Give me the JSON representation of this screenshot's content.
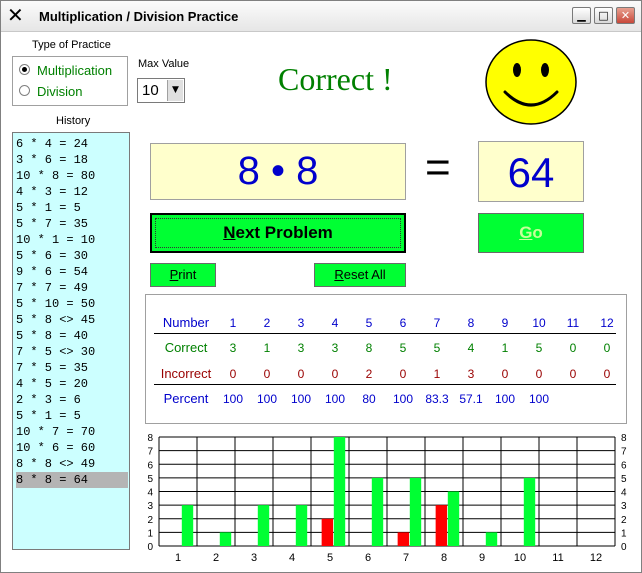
{
  "window": {
    "title": "Multiplication / Division Practice",
    "app_icon": "✕",
    "controls": [
      "minimize",
      "maximize",
      "close"
    ]
  },
  "type_of_practice": {
    "label": "Type of Practice",
    "options": [
      {
        "label": "Multiplication",
        "selected": true
      },
      {
        "label": "Division",
        "selected": false
      }
    ]
  },
  "max_value": {
    "label": "Max Value",
    "value": "10"
  },
  "history": {
    "label": "History",
    "items": [
      "6 * 4 = 24",
      "3 * 6 = 18",
      "10 * 8 = 80",
      "4 * 3 = 12",
      "5 * 1 = 5",
      "5 * 7 = 35",
      "10 * 1 = 10",
      "5 * 6 = 30",
      "9 * 6 = 54",
      "7 * 7 = 49",
      "5 * 10 = 50",
      "5 * 8 <> 45",
      "5 * 8 = 40",
      "7 * 5 <> 30",
      "7 * 5 = 35",
      "4 * 5 = 20",
      "2 * 3 = 6",
      "5 * 1 = 5",
      "10 * 7 = 70",
      "10 * 6 = 60",
      "8 * 8 <> 49",
      "8 * 8 = 64"
    ],
    "selected_index": 21
  },
  "feedback": {
    "message": "Correct !",
    "icon": "smiley-face-icon"
  },
  "problem": {
    "text": "8  •  8",
    "equals": "=",
    "answer": "64"
  },
  "buttons": {
    "next_problem": {
      "label": "Next Problem",
      "mnemonic": "N"
    },
    "go": {
      "label": "Go",
      "mnemonic": "G"
    },
    "print": {
      "label": "Print",
      "mnemonic": "P"
    },
    "reset_all": {
      "label": "Reset All",
      "mnemonic": "R"
    }
  },
  "stats": {
    "row_labels": {
      "number": "Number",
      "correct": "Correct",
      "incorrect": "Incorrect",
      "percent": "Percent"
    },
    "numbers": [
      "1",
      "2",
      "3",
      "4",
      "5",
      "6",
      "7",
      "8",
      "9",
      "10",
      "11",
      "12"
    ],
    "correct": [
      "3",
      "1",
      "3",
      "3",
      "8",
      "5",
      "5",
      "4",
      "1",
      "5",
      "0",
      "0"
    ],
    "incorrect": [
      "0",
      "0",
      "0",
      "0",
      "2",
      "0",
      "1",
      "3",
      "0",
      "0",
      "0",
      "0"
    ],
    "percent": [
      "100",
      "100",
      "100",
      "100",
      "80",
      "100",
      "83.3",
      "57.1",
      "100",
      "100",
      "",
      ""
    ]
  },
  "colors": {
    "correct": "#00ff33",
    "incorrect": "#ff0000",
    "number_text": "#0000cc",
    "correct_text": "#008000",
    "incorrect_text": "#990000",
    "history_bg": "#ccffff",
    "problem_bg": "#ffffcc"
  },
  "chart_data": {
    "type": "bar",
    "categories": [
      "1",
      "2",
      "3",
      "4",
      "5",
      "6",
      "7",
      "8",
      "9",
      "10",
      "11",
      "12"
    ],
    "series": [
      {
        "values": [
          3,
          1,
          3,
          3,
          8,
          5,
          5,
          4,
          1,
          5,
          0,
          0
        ]
      },
      {
        "values": [
          0,
          0,
          0,
          0,
          2,
          0,
          1,
          3,
          0,
          0,
          0,
          0
        ]
      }
    ],
    "ylim": [
      0,
      8
    ],
    "y_ticks": [
      "0",
      "1",
      "2",
      "3",
      "4",
      "5",
      "6",
      "7",
      "8"
    ],
    "grid": true
  }
}
